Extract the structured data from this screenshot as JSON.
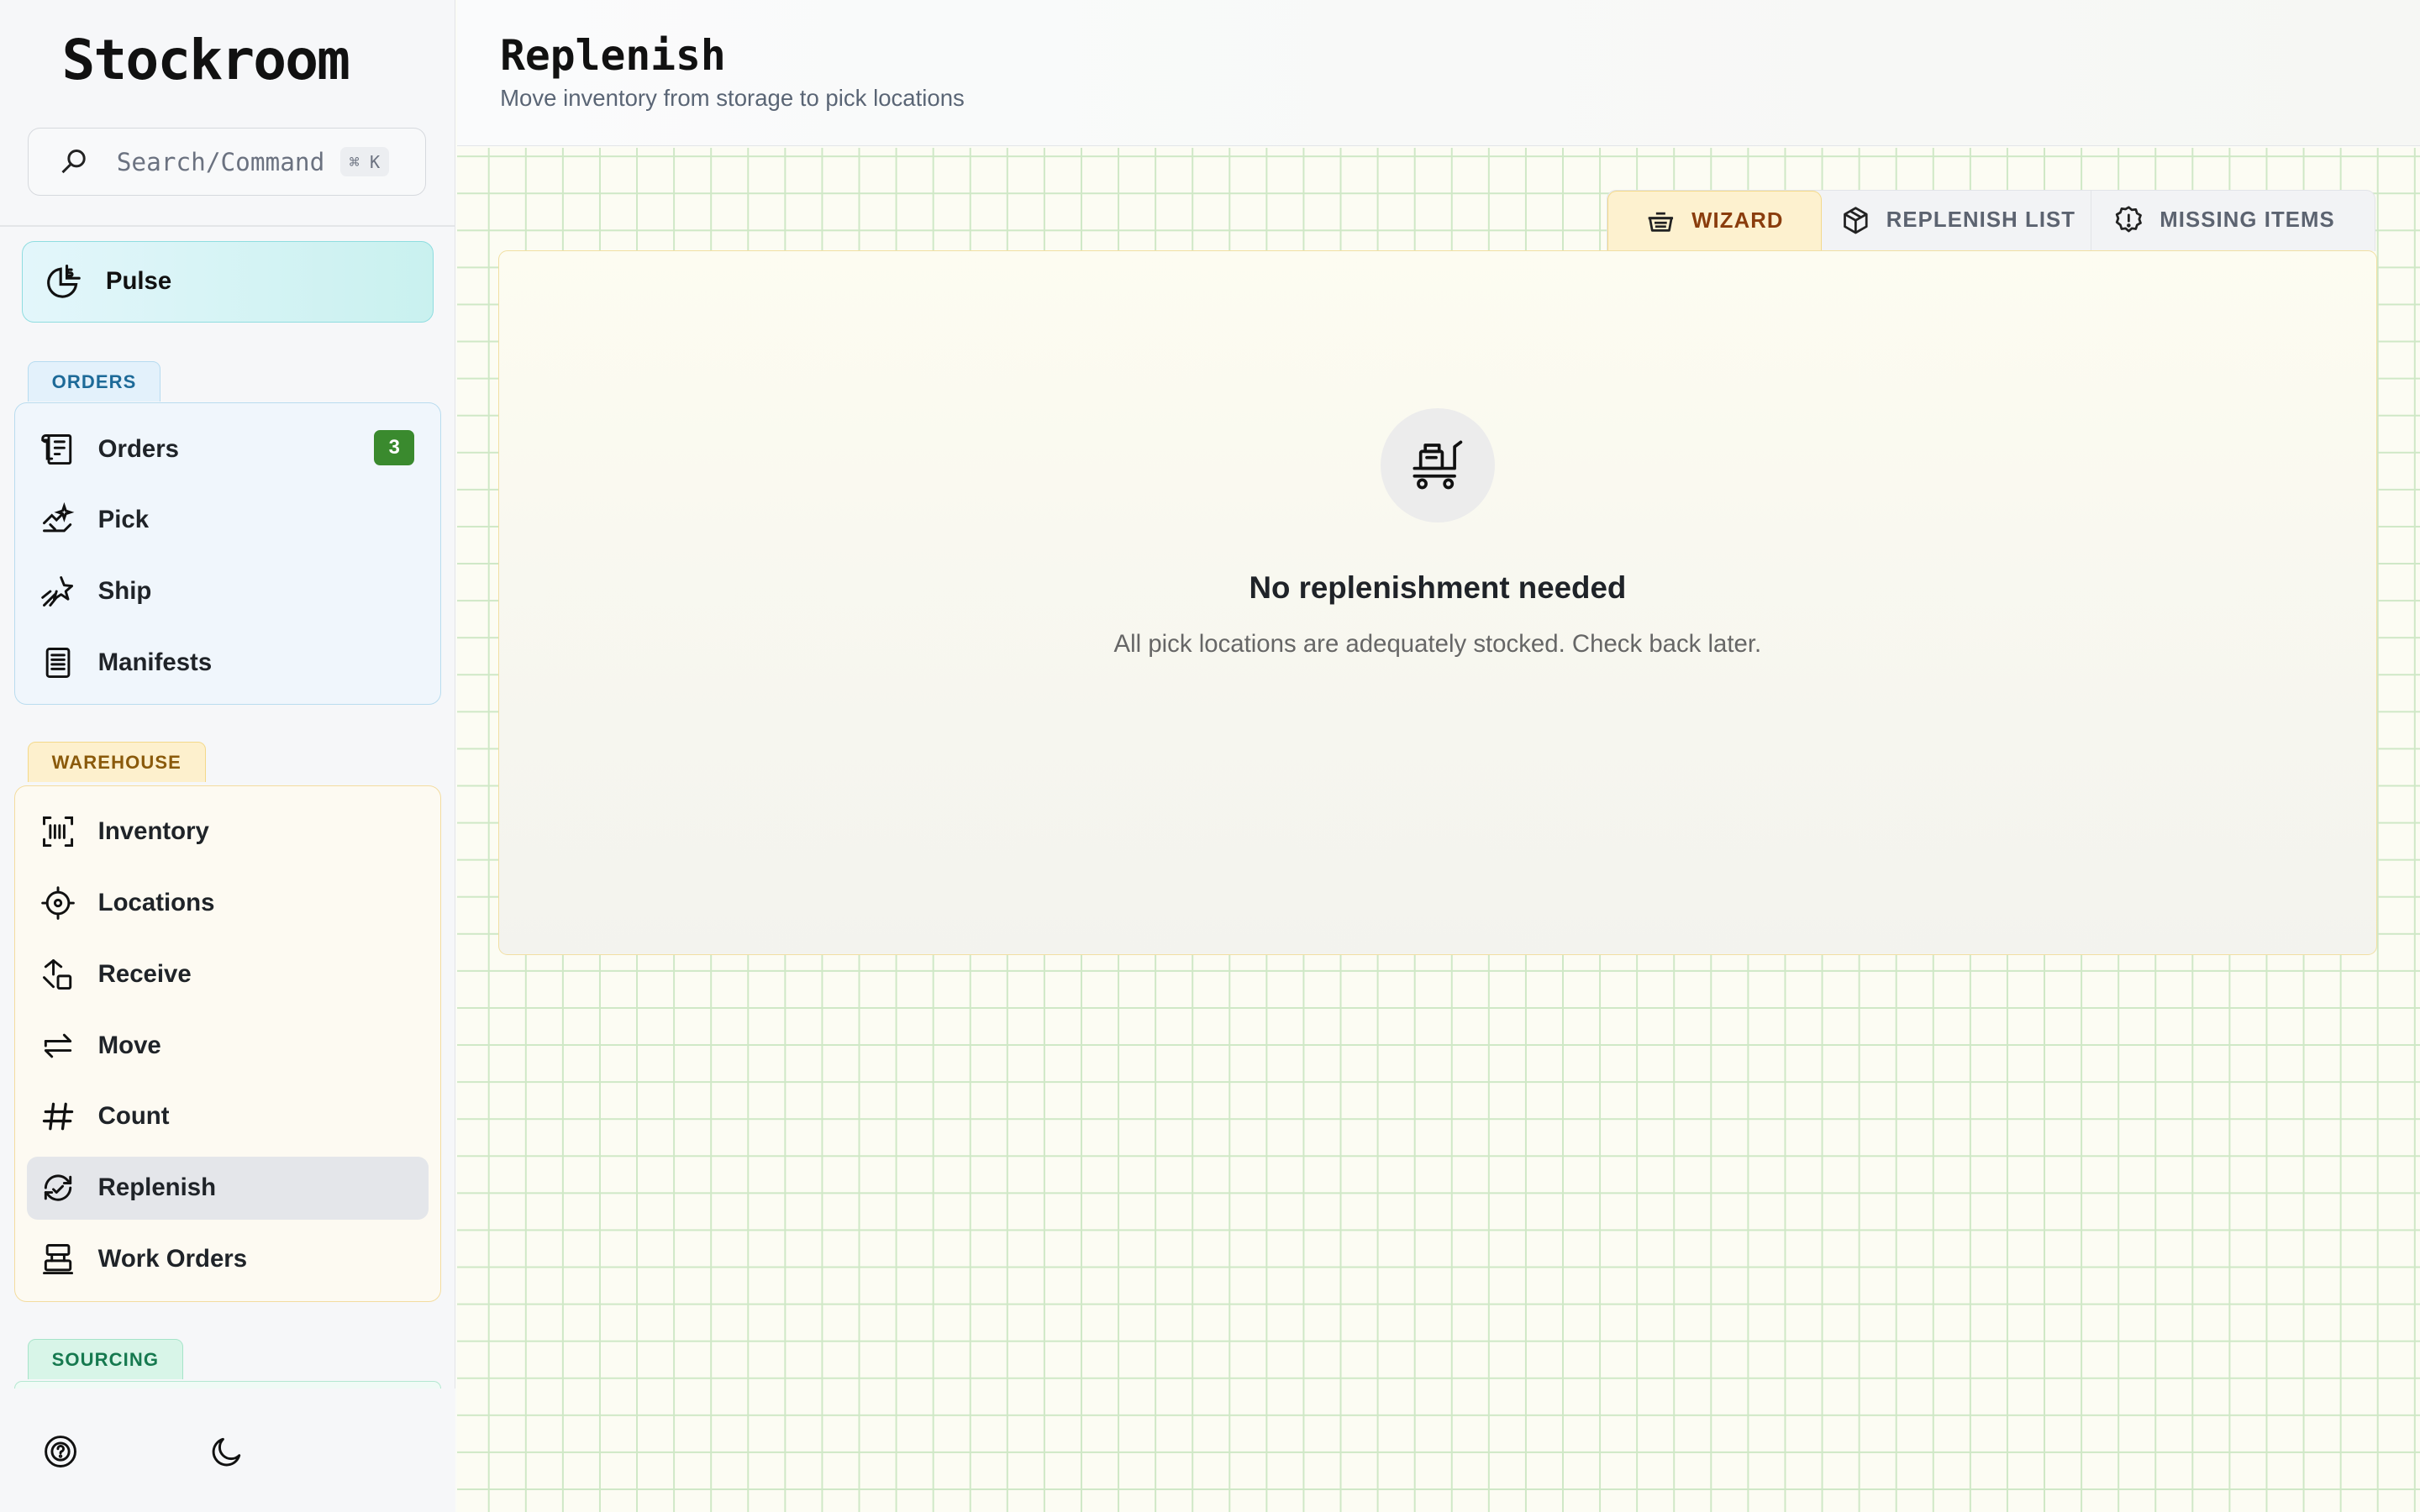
{
  "app": {
    "name": "Stockroom"
  },
  "search": {
    "placeholder": "Search/Command",
    "shortcut": "⌘ K"
  },
  "pulse": {
    "label": "Pulse"
  },
  "groups": {
    "orders": {
      "label": "ORDERS",
      "items": [
        {
          "label": "Orders",
          "icon": "receipt-dollar-icon",
          "badge": "3"
        },
        {
          "label": "Pick",
          "icon": "pick-hand-icon"
        },
        {
          "label": "Ship",
          "icon": "shooting-star-icon"
        },
        {
          "label": "Manifests",
          "icon": "document-list-icon"
        }
      ]
    },
    "warehouse": {
      "label": "WAREHOUSE",
      "items": [
        {
          "label": "Inventory",
          "icon": "barcode-scan-icon"
        },
        {
          "label": "Locations",
          "icon": "crosshair-icon"
        },
        {
          "label": "Receive",
          "icon": "receive-box-icon"
        },
        {
          "label": "Move",
          "icon": "arrows-transfer-icon"
        },
        {
          "label": "Count",
          "icon": "hash-icon"
        },
        {
          "label": "Replenish",
          "icon": "replenish-cycle-icon",
          "active": true
        },
        {
          "label": "Work Orders",
          "icon": "work-station-icon"
        }
      ]
    },
    "sourcing": {
      "label": "SOURCING"
    }
  },
  "page": {
    "title": "Replenish",
    "subtitle": "Move inventory from storage to pick locations"
  },
  "tabs": [
    {
      "label": "WIZARD",
      "icon": "basket-icon",
      "active": true
    },
    {
      "label": "REPLENISH LIST",
      "icon": "package-icon"
    },
    {
      "label": "MISSING ITEMS",
      "icon": "alert-badge-icon"
    }
  ],
  "empty_state": {
    "icon": "cart-trolley-icon",
    "title": "No replenishment needed",
    "message": "All pick locations are adequately stocked. Check back later."
  },
  "footer": {
    "help_icon": "help-circle-icon",
    "theme_icon": "moon-icon"
  },
  "colors": {
    "badge": "#3a8a2e",
    "active_tab_text": "#8a3d0d",
    "orders_tag": "#1d6a98",
    "warehouse_tag": "#8a5a0b",
    "sourcing_tag": "#16794f"
  }
}
